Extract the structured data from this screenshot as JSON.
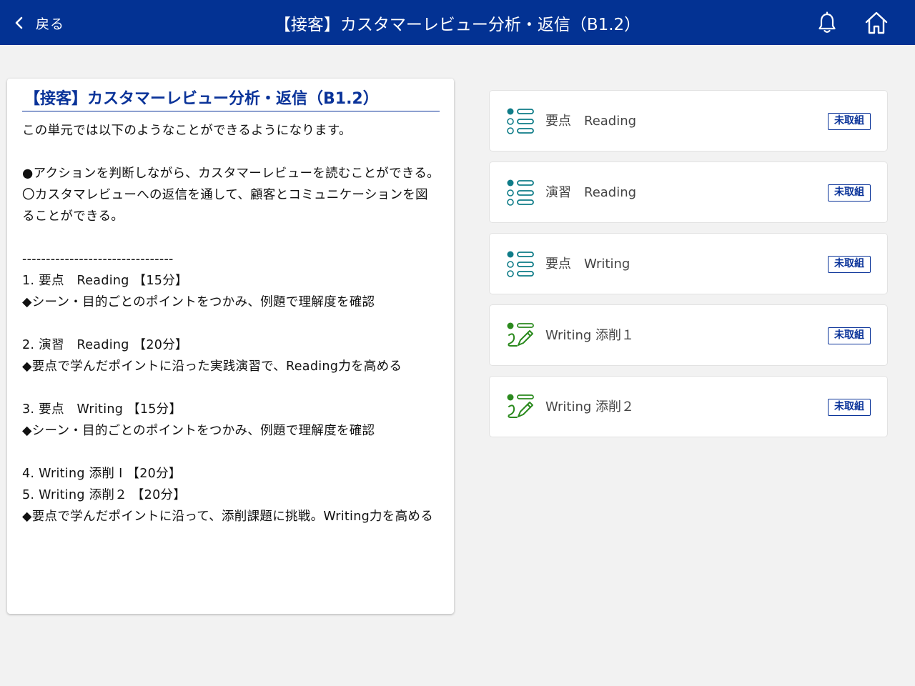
{
  "colors": {
    "header_bg": "#033293",
    "accent": "#0a3399",
    "list_icon": "#0f7c88",
    "edit_icon": "#2b8a1e"
  },
  "header": {
    "back_label": "戻る",
    "title": "【接客】カスタマーレビュー分析・返信（B1.2）",
    "back_icon": "chevron-left-icon",
    "bell_icon": "bell-icon",
    "home_icon": "home-icon"
  },
  "description": {
    "title": "【接客】カスタマーレビュー分析・返信（B1.2）",
    "lines": [
      "この単元では以下のようなことができるようになります。",
      "",
      "●アクションを判断しながら、カスタマーレビューを読むことができる。",
      "〇カスタマレビューへの返信を通して、顧客とコミュニケーションを図ることができる。",
      "",
      "--------------------------------",
      "1. 要点　Reading 【15分】",
      "◆シーン・目的ごとのポイントをつかみ、例題で理解度を確認",
      "",
      "2. 演習　Reading 【20分】",
      "◆要点で学んだポイントに沿った実践演習で、Reading力を高める",
      "",
      "3. 要点　Writing 【15分】",
      "◆シーン・目的ごとのポイントをつかみ、例題で理解度を確認",
      "",
      "4. Writing 添削 I 【20分】",
      "5. Writing 添削２ 【20分】",
      "◆要点で学んだポイントに沿って、添削課題に挑戦。Writing力を高める"
    ]
  },
  "lessons": [
    {
      "name": "要点　Reading",
      "status": "未取組",
      "icon": "list-icon"
    },
    {
      "name": "演習　Reading",
      "status": "未取組",
      "icon": "list-icon"
    },
    {
      "name": "要点　Writing",
      "status": "未取組",
      "icon": "list-icon"
    },
    {
      "name": "Writing 添削１",
      "status": "未取組",
      "icon": "pencil-edit-icon"
    },
    {
      "name": "Writing 添削２",
      "status": "未取組",
      "icon": "pencil-edit-icon"
    }
  ]
}
